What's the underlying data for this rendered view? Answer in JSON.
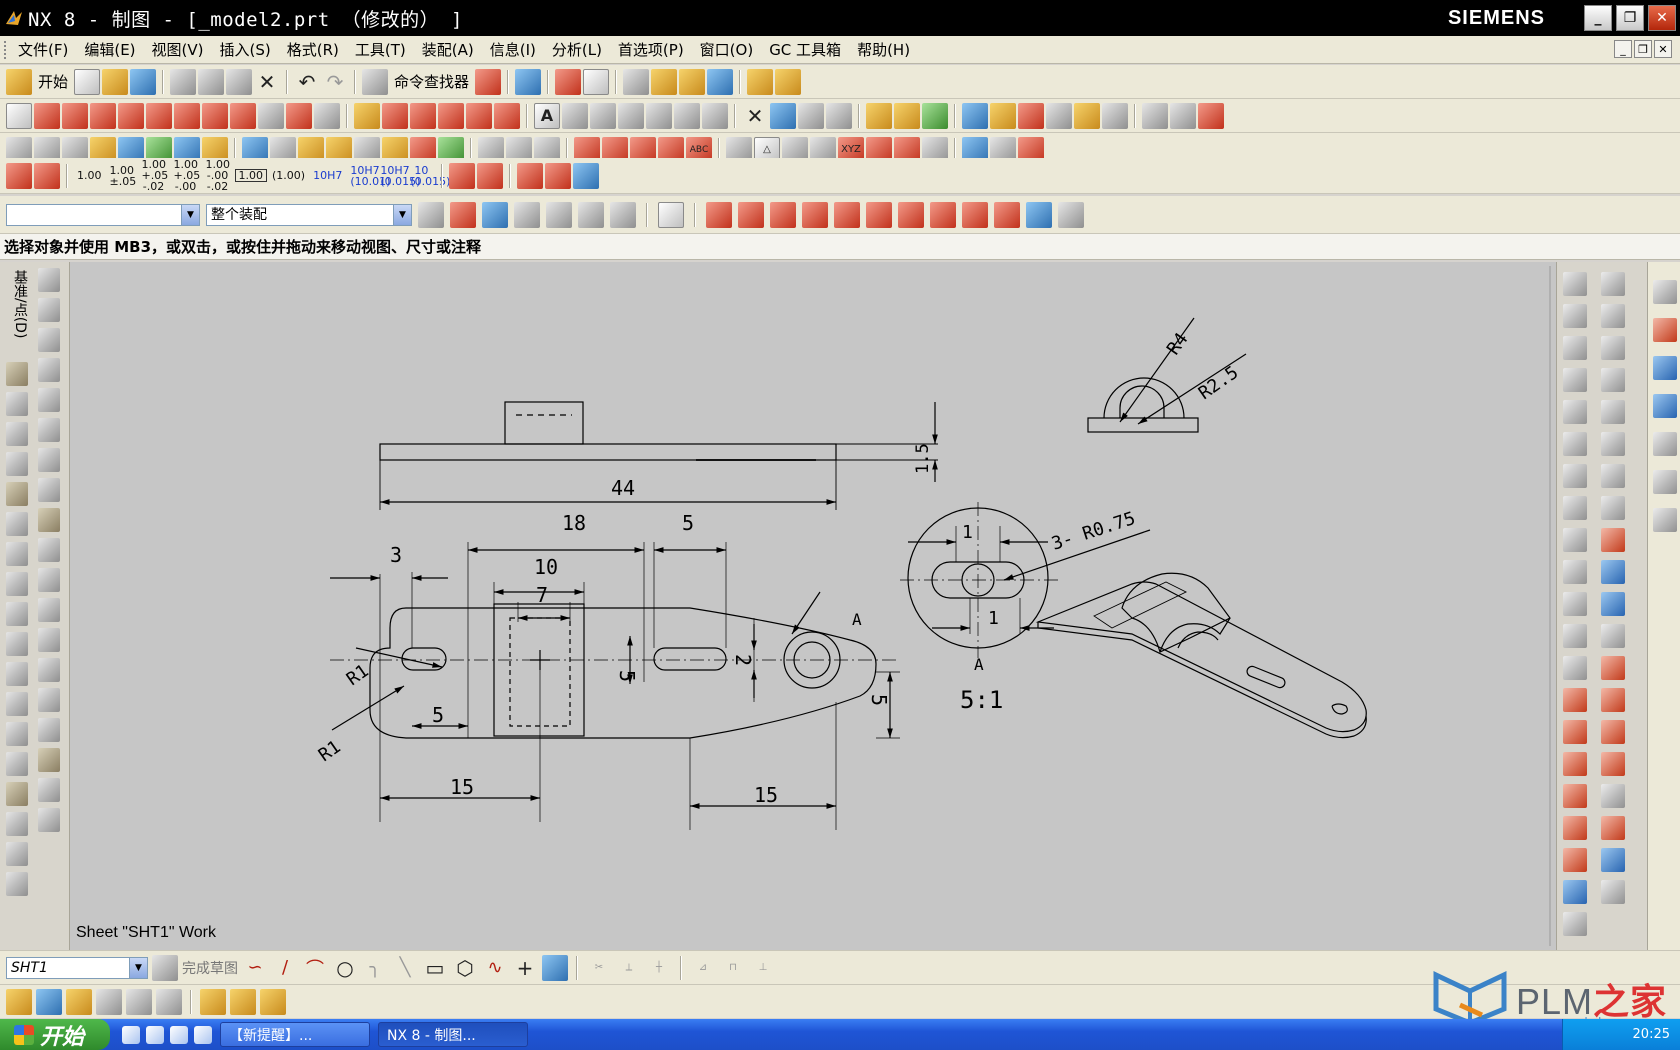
{
  "window": {
    "title": "NX 8 - 制图 - [_model2.prt （修改的） ]",
    "brand": "SIEMENS",
    "controls": [
      "_",
      "❐",
      "✕"
    ]
  },
  "menu": [
    "文件(F)",
    "编辑(E)",
    "视图(V)",
    "插入(S)",
    "格式(R)",
    "工具(T)",
    "装配(A)",
    "信息(I)",
    "分析(L)",
    "首选项(P)",
    "窗口(O)",
    "GC 工具箱",
    "帮助(H)"
  ],
  "toolbar1": {
    "start_label": "开始",
    "command_finder_label": "命令查找器"
  },
  "toolbar4": {
    "tolerances": [
      "1.00",
      "1.00 ±.05",
      "1.00 +.05 -.02",
      "1.00 +.05 -.00",
      "1.00 -.00 -.02",
      "1.00",
      "(1.00)",
      "10H7",
      "10H7 (10.01)",
      "10H7 (0.015)",
      "10 (0.015)"
    ]
  },
  "selection_bar": {
    "filter_value": "",
    "scope_value": "整个装配"
  },
  "prompt": "选择对象并使用 MB3，或双击，或按住并拖动来移动视图、尺寸或注释",
  "left_tab": "基准/点(D)",
  "drawing": {
    "dims": {
      "d44": "44",
      "d15_thk": "1.5",
      "d18": "18",
      "d5a": "5",
      "d3": "3",
      "d10": "10",
      "d7": "7",
      "d5b": "5",
      "d2": "2",
      "d5c": "5",
      "d5d": "5",
      "d15a": "15",
      "d15b": "15",
      "r1a": "R1",
      "r1b": "R1",
      "r4": "R4",
      "r25": "R2.5",
      "r075": "3- R0.75",
      "d1a": "1",
      "d1b": "1",
      "label_a": "A",
      "label_a2": "A",
      "scale": "5:1"
    },
    "sheet_label": "Sheet \"SHT1\" Work"
  },
  "sketch_bar": {
    "sheet_value": "SHT1",
    "finish_sketch_label": "完成草图"
  },
  "taskbar": {
    "start_label": "开始",
    "tasks": [
      "【新提醒】...",
      "NX 8 - 制图..."
    ],
    "clock": "20:25"
  },
  "watermark": {
    "text": "PLM",
    "cn": "之家",
    "url": "www.plmhome.com"
  }
}
